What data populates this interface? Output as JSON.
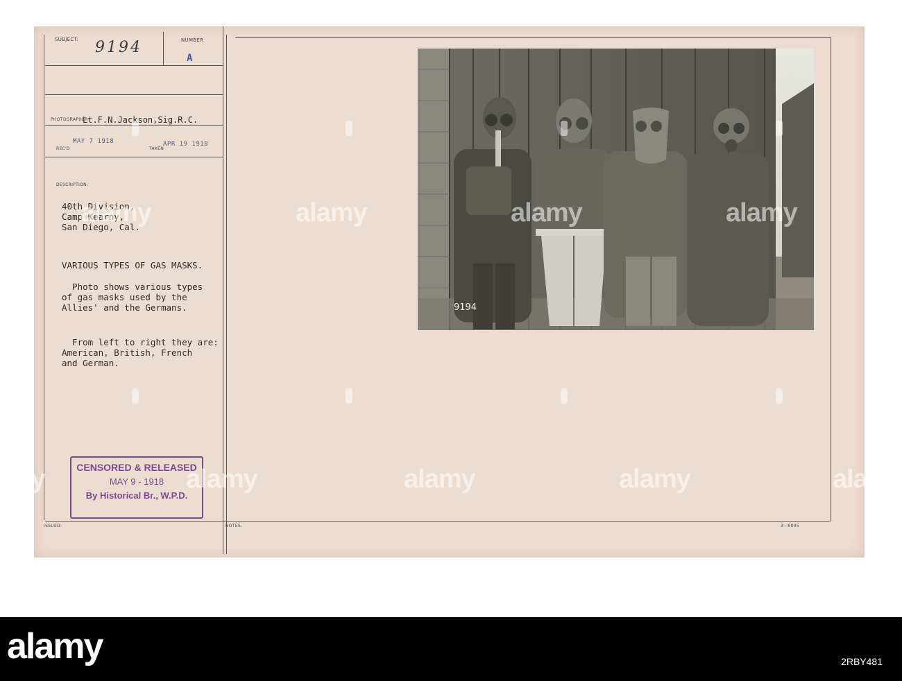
{
  "card": {
    "labels": {
      "subject": "SUBJECT:",
      "number": "NUMBER",
      "photographer": "PHOTOGRAPHER",
      "recd": "REC'D",
      "taken": "TAKEN",
      "description": "DESCRIPTION:",
      "issued": "ISSUED:",
      "notes": "NOTES."
    },
    "subject_number": "9194",
    "number_letter": "A",
    "photographer_name": "Lt.F.N.Jackson,Sig.R.C.",
    "recd_date": "MAY 7  1918",
    "taken_date": "APR 19 1918",
    "description_lines": [
      "40th Division,",
      "Camp Kearny,",
      "San Diego, Cal."
    ],
    "title": "VARIOUS TYPES OF GAS MASKS.",
    "paragraph1": [
      "  Photo shows various types",
      "of gas masks used by the",
      "Allies' and the Germans."
    ],
    "paragraph2": [
      "  From left to right they are:",
      "American, British, French",
      "and German."
    ],
    "censor_stamp": {
      "line1": "CENSORED & RELEASED",
      "line2": "MAY 9 - 1918",
      "line3": "By Historical Br., W.P.D."
    },
    "form_number": "3—6005",
    "photo_negative_number": "9194"
  },
  "watermark": "alamy",
  "footer": {
    "brand": "alamy",
    "image_id": "2RBY481"
  }
}
